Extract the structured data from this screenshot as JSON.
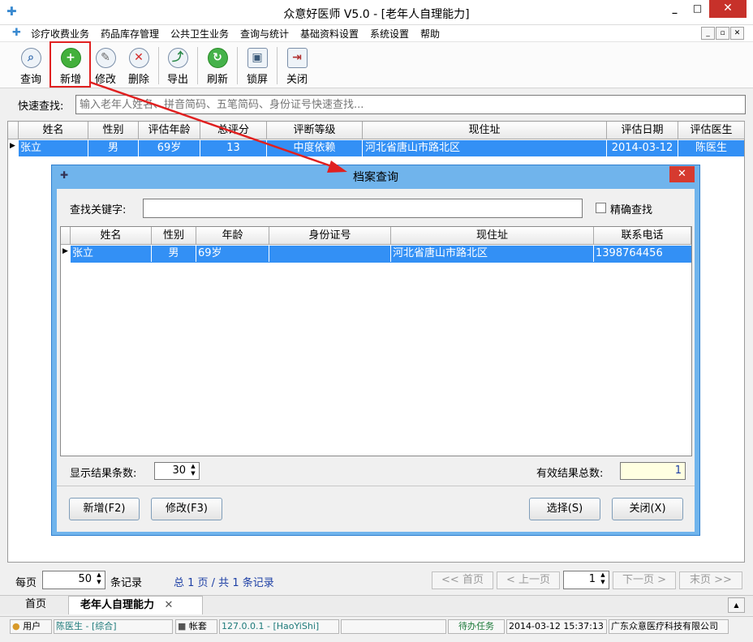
{
  "window": {
    "title": "众意好医师 V5.0 - [老年人自理能力]"
  },
  "menu": {
    "items": [
      "诊疗收费业务",
      "药品库存管理",
      "公共卫生业务",
      "查询与统计",
      "基础资料设置",
      "系统设置",
      "帮助"
    ]
  },
  "toolbar": {
    "query": "查询",
    "add": "新增",
    "edit": "修改",
    "delete": "删除",
    "export": "导出",
    "refresh": "刷新",
    "lock": "锁屏",
    "close": "关闭"
  },
  "quick_search": {
    "label": "快速查找:",
    "placeholder": "输入老年人姓名、拼音简码、五笔简码、身份证号快速查找..."
  },
  "grid": {
    "columns": [
      "姓名",
      "性别",
      "评估年龄",
      "总评分",
      "评断等级",
      "现住址",
      "评估日期",
      "评估医生"
    ],
    "rows": [
      {
        "name": "张立",
        "gender": "男",
        "age": "69岁",
        "score": "13",
        "level": "中度依赖",
        "address": "河北省唐山市路北区",
        "date": "2014-03-12",
        "doctor": "陈医生"
      }
    ]
  },
  "dialog": {
    "title": "档案查询",
    "keyword_label": "查找关键字:",
    "keyword_value": "",
    "exact_label": "精确查找",
    "columns": [
      "姓名",
      "性别",
      "年龄",
      "身份证号",
      "现住址",
      "联系电话"
    ],
    "rows": [
      {
        "name": "张立",
        "gender": "男",
        "age": "69岁",
        "id_number": "",
        "address": "河北省唐山市路北区",
        "phone": "1398764456"
      }
    ],
    "display_count_label": "显示结果条数:",
    "display_count": "30",
    "total_label": "有效结果总数:",
    "total": "1",
    "add_button": "新增(F2)",
    "edit_button": "修改(F3)",
    "select_button": "选择(S)",
    "close_button": "关闭(X)"
  },
  "pager": {
    "per_page_label": "每页",
    "per_page": "50",
    "records_label": "条记录",
    "summary": "总 1 页 / 共 1 条记录",
    "first": "<< 首页",
    "prev": "< 上一页",
    "page": "1",
    "next": "下一页 >",
    "last": "末页 >>"
  },
  "tabs": {
    "home": "首页",
    "active": "老年人自理能力"
  },
  "statusbar": {
    "user_label": "用户",
    "user": "陈医生 - [综合]",
    "account_label": "帐套",
    "server": "127.0.0.1 - [HaoYiShi]",
    "todo": "待办任务",
    "datetime": "2014-03-12 15:37:13",
    "company": "广东众意医疗科技有限公司"
  },
  "colors": {
    "selection": "#3390f5",
    "dialog_frame": "#70b4ec",
    "annotation_red": "#e02020",
    "close_red": "#d63a2f"
  }
}
